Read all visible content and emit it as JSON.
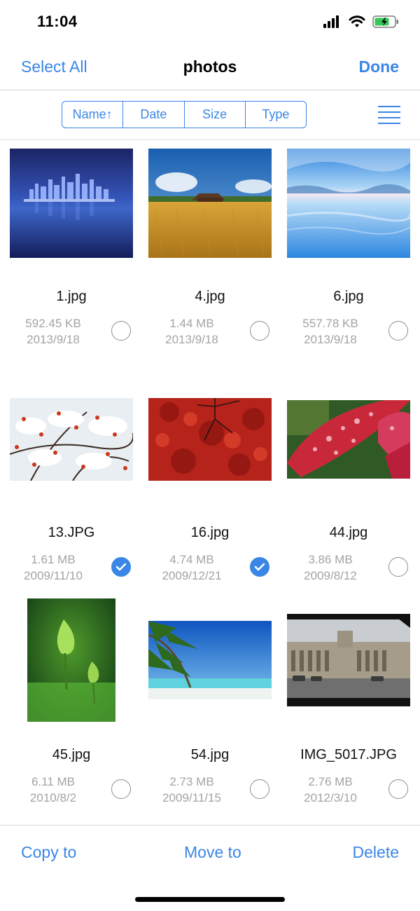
{
  "status_bar": {
    "time": "11:04",
    "icons": [
      "signal-icon",
      "wifi-icon",
      "battery-charging-icon"
    ]
  },
  "nav": {
    "left": "Select All",
    "title": "photos",
    "right": "Done"
  },
  "sort": {
    "segments": [
      "Name↑",
      "Date",
      "Size",
      "Type"
    ],
    "view_toggle_icon": "list-view-icon"
  },
  "files": [
    {
      "name": "1.jpg",
      "size": "592.45 KB",
      "date": "2013/9/18",
      "selected": false,
      "thumbnail": "city-skyline-night"
    },
    {
      "name": "4.jpg",
      "size": "1.44 MB",
      "date": "2013/9/18",
      "selected": false,
      "thumbnail": "wheat-field-barn"
    },
    {
      "name": "6.jpg",
      "size": "557.78 KB",
      "date": "2013/9/18",
      "selected": false,
      "thumbnail": "blue-lake-reflection"
    },
    {
      "name": "13.JPG",
      "size": "1.61 MB",
      "date": "2009/11/10",
      "selected": true,
      "thumbnail": "snowy-red-berries"
    },
    {
      "name": "16.jpg",
      "size": "4.74 MB",
      "date": "2009/12/21",
      "selected": true,
      "thumbnail": "red-maple-leaves"
    },
    {
      "name": "44.jpg",
      "size": "3.86 MB",
      "date": "2009/8/12",
      "selected": false,
      "thumbnail": "red-leaf-water-drops"
    },
    {
      "name": "45.jpg",
      "size": "6.11 MB",
      "date": "2010/8/2",
      "selected": false,
      "thumbnail": "green-lotus-buds"
    },
    {
      "name": "54.jpg",
      "size": "2.73 MB",
      "date": "2009/11/15",
      "selected": false,
      "thumbnail": "palm-beach"
    },
    {
      "name": "IMG_5017.JPG",
      "size": "2.76 MB",
      "date": "2012/3/10",
      "selected": false,
      "thumbnail": "historic-building-street"
    }
  ],
  "toolbar": {
    "copy": "Copy to",
    "move": "Move to",
    "delete": "Delete"
  },
  "colors": {
    "accent": "#3a86e6",
    "meta_text": "#a3a3a3",
    "divider": "#d6d6d6"
  }
}
